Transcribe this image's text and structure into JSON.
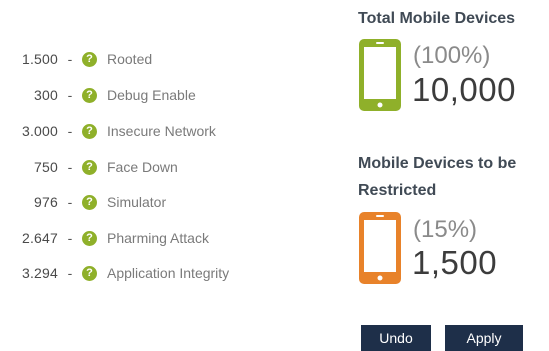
{
  "checks": [
    {
      "count": "1.500",
      "label": "Rooted"
    },
    {
      "count": "300",
      "label": "Debug Enable"
    },
    {
      "count": "3.000",
      "label": "Insecure Network"
    },
    {
      "count": "750",
      "label": "Face Down"
    },
    {
      "count": "976",
      "label": "Simulator"
    },
    {
      "count": "2.647",
      "label": "Pharming Attack"
    },
    {
      "count": "3.294",
      "label": "Application Integrity"
    }
  ],
  "separator": "-",
  "help_icon_glyph": "?",
  "help_icon_name": "question-circle-icon",
  "total": {
    "title": "Total Mobile Devices",
    "percent": "(100%)",
    "value": "10,000",
    "color": "#8fb02a",
    "icon": "phone-icon"
  },
  "restricted": {
    "title_line1": "Mobile Devices to be",
    "title_line2": "Restricted",
    "percent": "(15%)",
    "value": "1,500",
    "color": "#e8822a",
    "icon": "phone-icon"
  },
  "buttons": {
    "undo": "Undo",
    "apply": "Apply"
  }
}
